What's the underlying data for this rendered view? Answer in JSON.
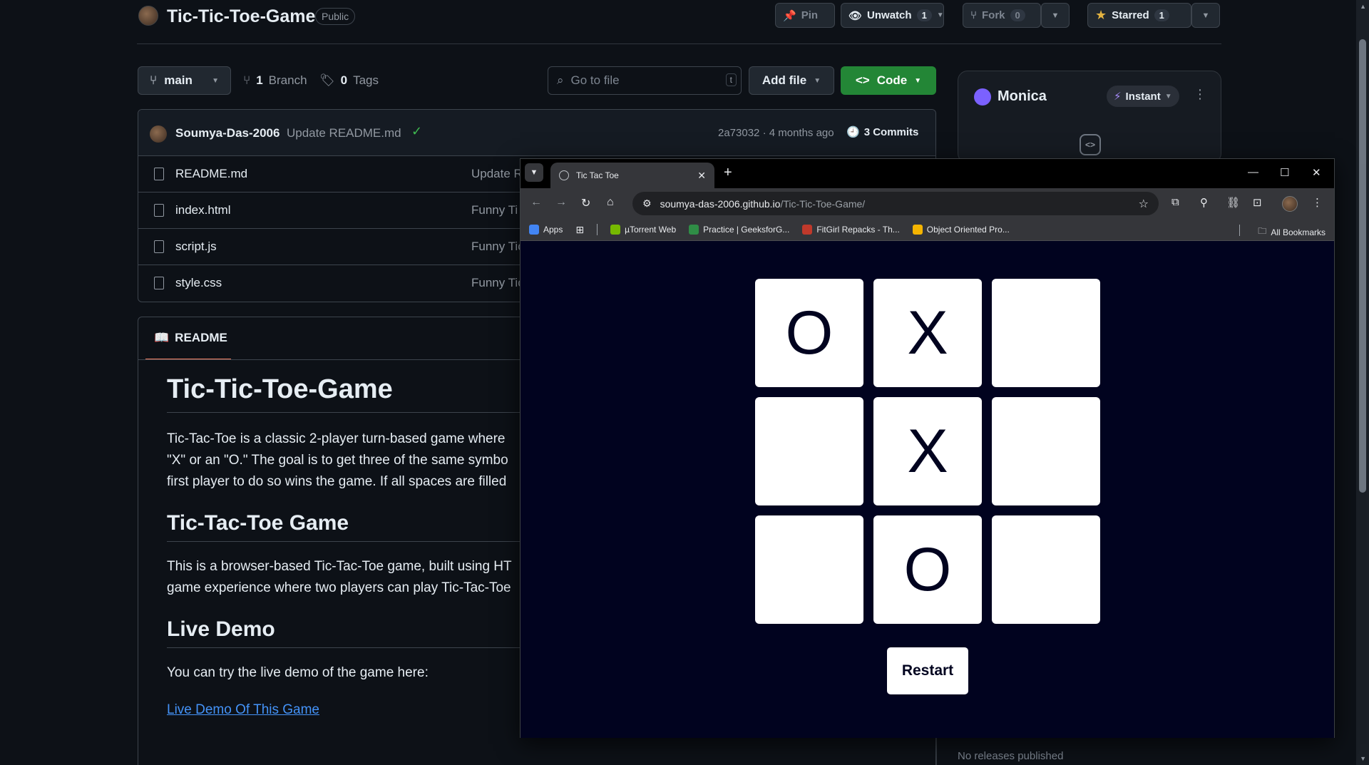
{
  "repo": {
    "title": "Tic-Tic-Toe-Game",
    "visibility": "Public",
    "pin_label": "Pin",
    "unwatch_label": "Unwatch",
    "unwatch_count": "1",
    "fork_label": "Fork",
    "fork_count": "0",
    "starred_label": "Starred",
    "starred_count": "1"
  },
  "toolbar": {
    "branch": "main",
    "branches_count": "1",
    "branches_label": "Branch",
    "tags_count": "0",
    "tags_label": "Tags",
    "goto_placeholder": "Go to file",
    "goto_key": "t",
    "add_file_label": "Add file",
    "code_label": "Code"
  },
  "commit": {
    "author": "Soumya-Das-2006",
    "message": "Update README.md",
    "hash_time": "2a73032 · 4 months ago",
    "commits_label": "3 Commits"
  },
  "files": [
    {
      "name": "README.md",
      "message": "Update R"
    },
    {
      "name": "index.html",
      "message": "Funny Ti"
    },
    {
      "name": "script.js",
      "message": "Funny Tic"
    },
    {
      "name": "style.css",
      "message": "Funny Tic"
    }
  ],
  "readme": {
    "tab_label": "README",
    "h1": "Tic-Tic-Toe-Game",
    "p1_line1": "Tic-Tac-Toe is a classic 2-player turn-based game where",
    "p1_line2": "\"X\" or an \"O.\" The goal is to get three of the same symbo",
    "p1_line3": "first player to do so wins the game. If all spaces are filled",
    "h2_game": "Tic-Tac-Toe Game",
    "p2_line1": "This is a browser-based Tic-Tac-Toe game, built using HT",
    "p2_line2": "game experience where two players can play Tic-Tac-Toe",
    "h2_demo": "Live Demo",
    "p3": "You can try the live demo of the game here:",
    "demo_link": "Live Demo Of This Game"
  },
  "sidebar": {
    "assistant_name": "Monica",
    "mode_label": "Instant",
    "no_releases": "No releases published"
  },
  "browser": {
    "tab_title": "Tic Tac Toe",
    "url_host": "soumya-das-2006.github.io",
    "url_path": "/Tic-Tic-Toe-Game/",
    "bookmarks": [
      {
        "label": "Apps",
        "color": "#4285f4"
      },
      {
        "label": "µTorrent Web",
        "color": "#76b900"
      },
      {
        "label": "Practice | GeeksforG...",
        "color": "#2f8d46"
      },
      {
        "label": "FitGirl Repacks - Th...",
        "color": "#c0392b"
      },
      {
        "label": "Object Oriented Pro...",
        "color": "#f4b400"
      }
    ],
    "all_bookmarks_label": "All Bookmarks"
  },
  "game": {
    "cells": [
      "O",
      "X",
      "",
      "",
      "X",
      "",
      "",
      "O",
      ""
    ],
    "restart_label": "Restart",
    "background": "#01031f"
  },
  "colors": {
    "accent_green": "#238636",
    "link_blue": "#4493f8",
    "tab_underline": "#f78166"
  }
}
